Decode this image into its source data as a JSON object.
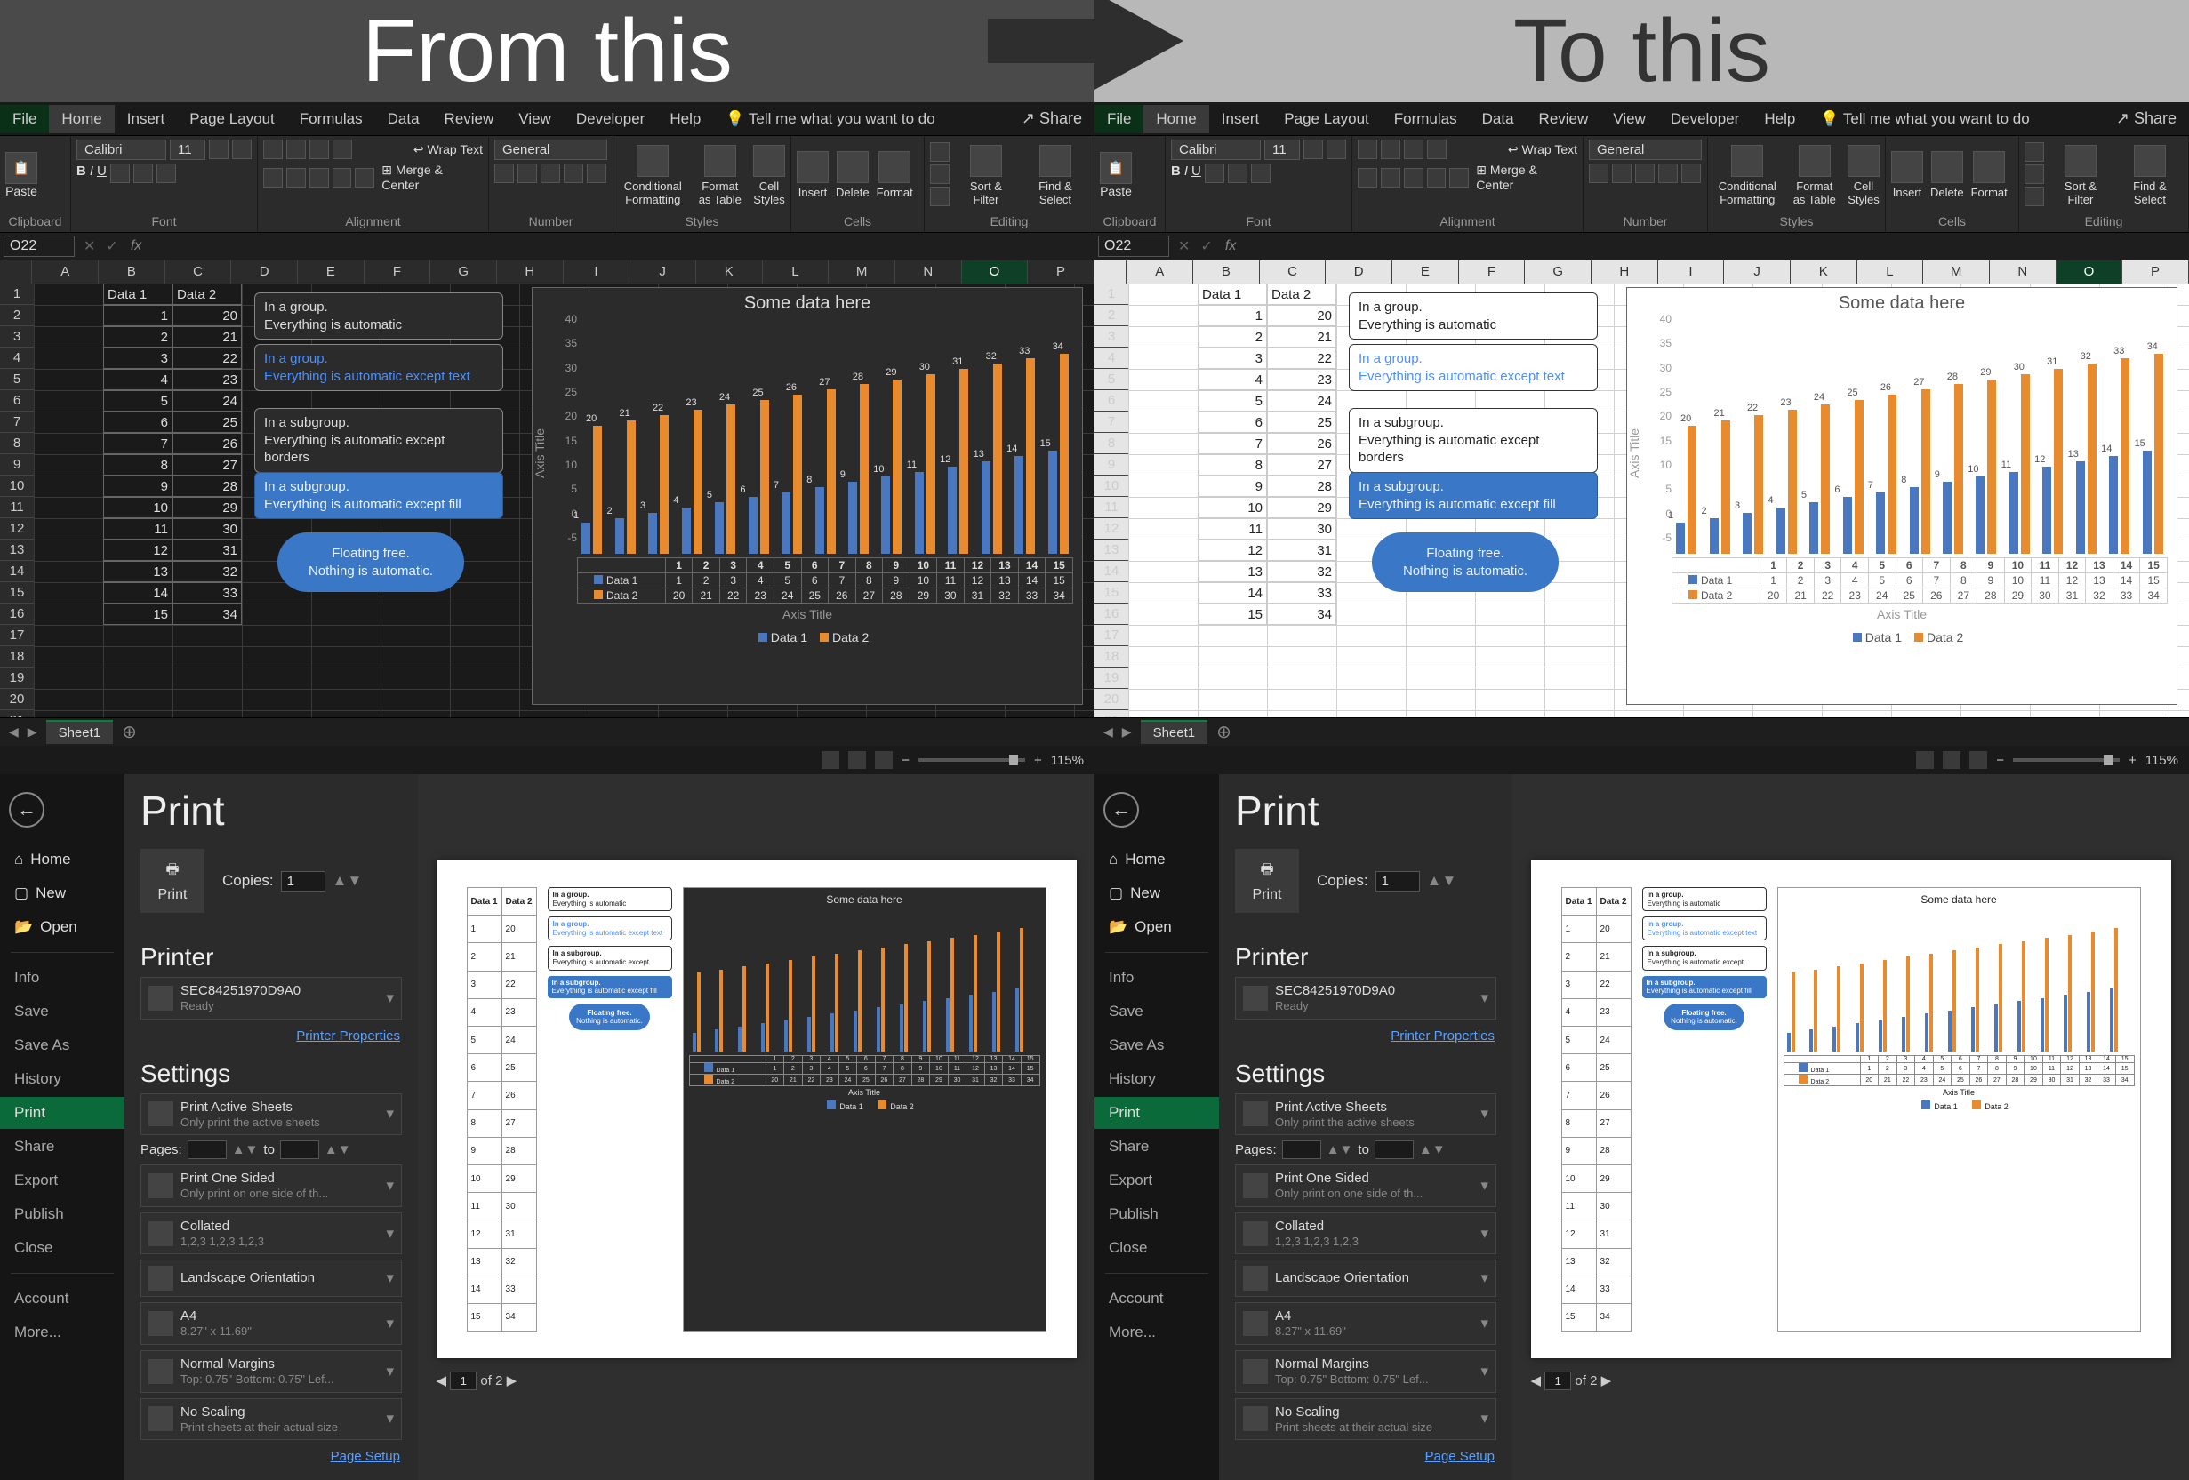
{
  "header": {
    "left": "From this",
    "right": "To this"
  },
  "ribbon": {
    "tabs": [
      "File",
      "Home",
      "Insert",
      "Page Layout",
      "Formulas",
      "Data",
      "Review",
      "View",
      "Developer",
      "Help"
    ],
    "tell_me": "Tell me what you want to do",
    "share": "Share",
    "groups": {
      "clipboard": "Clipboard",
      "font": "Font",
      "alignment": "Alignment",
      "number": "Number",
      "styles": "Styles",
      "cells": "Cells",
      "editing": "Editing"
    },
    "font_name": "Calibri",
    "font_size": "11",
    "number_format": "General",
    "wrap_text": "Wrap Text",
    "merge_center": "Merge & Center",
    "cond_fmt": "Conditional Formatting",
    "fmt_table": "Format as Table",
    "cell_styles": "Cell Styles",
    "insert": "Insert",
    "delete": "Delete",
    "format": "Format",
    "sort_filter": "Sort & Filter",
    "find_select": "Find & Select",
    "paste": "Paste"
  },
  "namebox": "O22",
  "columns": [
    "A",
    "B",
    "C",
    "D",
    "E",
    "F",
    "G",
    "H",
    "I",
    "J",
    "K",
    "L",
    "M",
    "N",
    "O",
    "P"
  ],
  "rows": 22,
  "selected_col": "O",
  "selected_row": 22,
  "data_headers": [
    "Data 1",
    "Data 2"
  ],
  "chart_data": {
    "type": "bar",
    "title": "Some data here",
    "xlabel": "Axis Title",
    "ylabel": "Axis Title",
    "ylim": [
      -5,
      40
    ],
    "yticks": [
      -5,
      0,
      5,
      10,
      15,
      20,
      25,
      30,
      35,
      40
    ],
    "categories": [
      1,
      2,
      3,
      4,
      5,
      6,
      7,
      8,
      9,
      10,
      11,
      12,
      13,
      14,
      15
    ],
    "series": [
      {
        "name": "Data 1",
        "color": "#4a78c0",
        "values": [
          1,
          2,
          3,
          4,
          5,
          6,
          7,
          8,
          9,
          10,
          11,
          12,
          13,
          14,
          15
        ]
      },
      {
        "name": "Data 2",
        "color": "#e88a2e",
        "values": [
          20,
          21,
          22,
          23,
          24,
          25,
          26,
          27,
          28,
          29,
          30,
          31,
          32,
          33,
          34
        ]
      }
    ]
  },
  "shapes": {
    "s1": {
      "l1": "In a group.",
      "l2": "Everything is automatic"
    },
    "s2": {
      "l1": "In a group.",
      "l2": "Everything is automatic except text"
    },
    "s3": {
      "l1": "In a subgroup.",
      "l2": "Everything is automatic except borders"
    },
    "s4": {
      "l1": "In a subgroup.",
      "l2": "Everything is automatic except fill"
    },
    "s5": {
      "l1": "Floating free.",
      "l2": "Nothing is automatic."
    }
  },
  "sheet_tab": "Sheet1",
  "zoom": "115%",
  "backstage": {
    "title": "Print",
    "copies_label": "Copies:",
    "copies_value": "1",
    "print_button": "Print",
    "nav": {
      "home": "Home",
      "new": "New",
      "open": "Open",
      "info": "Info",
      "save": "Save",
      "save_as": "Save As",
      "history": "History",
      "print": "Print",
      "share": "Share",
      "export": "Export",
      "publish": "Publish",
      "close": "Close",
      "account": "Account",
      "more": "More..."
    },
    "printer_h": "Printer",
    "printer_name": "SEC84251970D9A0",
    "printer_status": "Ready",
    "printer_props": "Printer Properties",
    "settings_h": "Settings",
    "settings": {
      "active_sheets": {
        "t": "Print Active Sheets",
        "s": "Only print the active sheets"
      },
      "pages_label": "Pages:",
      "pages_to": "to",
      "one_sided": {
        "t": "Print One Sided",
        "s": "Only print on one side of th..."
      },
      "collated": {
        "t": "Collated",
        "s": "1,2,3   1,2,3   1,2,3"
      },
      "orientation": {
        "t": "Landscape Orientation",
        "s": ""
      },
      "paper": {
        "t": "A4",
        "s": "8.27\" x 11.69\""
      },
      "margins": {
        "t": "Normal Margins",
        "s": "Top: 0.75\" Bottom: 0.75\" Lef..."
      },
      "scaling": {
        "t": "No Scaling",
        "s": "Print sheets at their actual size"
      }
    },
    "page_setup": "Page Setup",
    "page_counter": {
      "current": "1",
      "of_label": "of",
      "total": "2"
    }
  }
}
